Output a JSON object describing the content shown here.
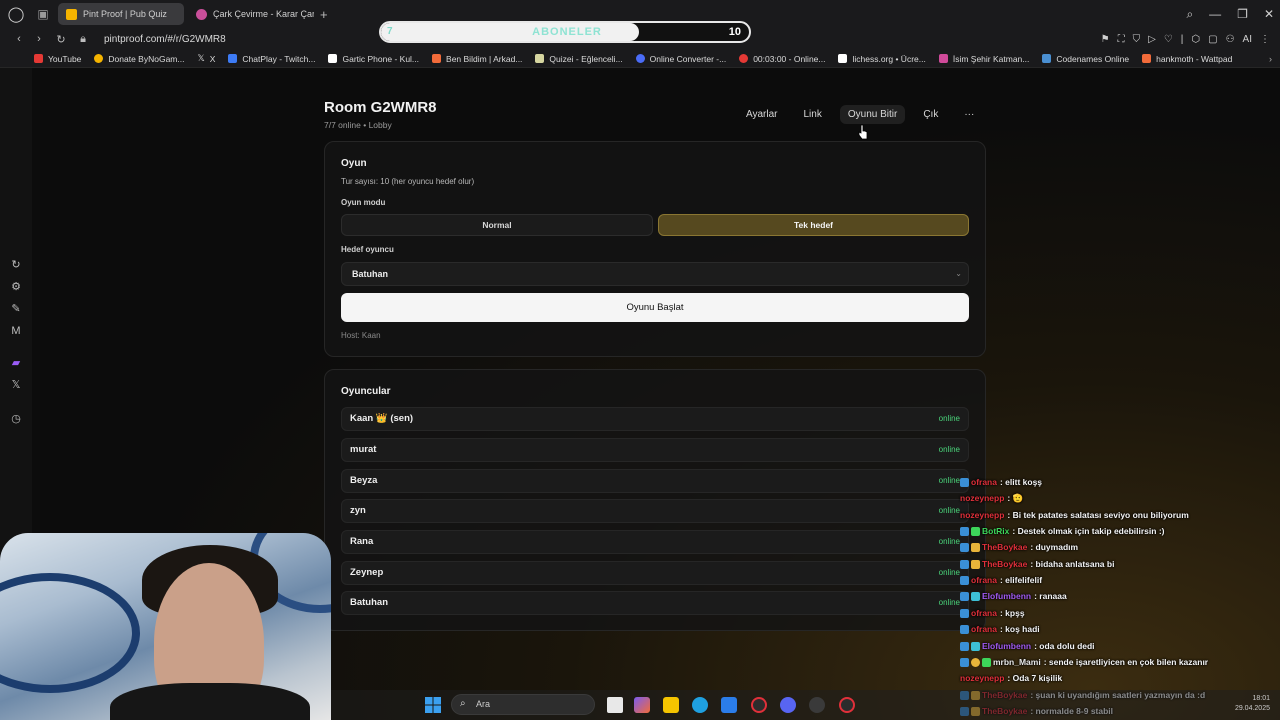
{
  "browser": {
    "tabs": [
      {
        "label": "Pint Proof | Pub Quiz",
        "active": true,
        "favicon_color": "#f5b400"
      },
      {
        "label": "Çark Çevirme - Karar Çark",
        "active": false,
        "favicon_color": "#c94f9a"
      }
    ],
    "url": "pintproof.com/#/r/G2WMR8",
    "bookmarks": [
      {
        "label": "YouTube",
        "color": "#e53935"
      },
      {
        "label": "Donate ByNoGam...",
        "color": "#f5b400"
      },
      {
        "label": "X",
        "color": "#ffffff"
      },
      {
        "label": "ChatPlay - Twitch...",
        "color": "#3d7bf5"
      },
      {
        "label": "Gartic Phone - Kul...",
        "color": "#ffffff"
      },
      {
        "label": "Ben Bildim | Arkad...",
        "color": "#f26b3a"
      },
      {
        "label": "Quizei - Eğlenceli...",
        "color": "#d6d6a0"
      },
      {
        "label": "Online Converter -...",
        "color": "#4a6cf7"
      },
      {
        "label": "00:03:00 - Online...",
        "color": "#e53935"
      },
      {
        "label": "lichess.org • Ücre...",
        "color": "#ffffff"
      },
      {
        "label": "İsim Şehir Katman...",
        "color": "#d04a9a"
      },
      {
        "label": "Codenames Online",
        "color": "#4a8fd1"
      },
      {
        "label": "hankmoth - Wattpad",
        "color": "#f26b3a"
      }
    ]
  },
  "subscriber_goal": {
    "start": "7",
    "label": "ABONELER",
    "goal": "10",
    "progress": 0.7
  },
  "room": {
    "title": "Room G2WMR8",
    "subtitle": "7/7 online • Lobby",
    "nav": [
      "Ayarlar",
      "Link",
      "Oyunu Bitir",
      "Çık",
      "···"
    ]
  },
  "game": {
    "title": "Oyun",
    "rounds_text": "Tur sayısı: 10 (her oyuncu hedef olur)",
    "mode_label": "Oyun modu",
    "modes": [
      {
        "label": "Normal",
        "selected": false
      },
      {
        "label": "Tek hedef",
        "selected": true
      }
    ],
    "target_label": "Hedef oyuncu",
    "target_value": "Batuhan",
    "start_button": "Oyunu Başlat",
    "host_text": "Host: Kaan"
  },
  "players": {
    "title": "Oyuncular",
    "list": [
      {
        "name": "Kaan 👑 (sen)",
        "status": "online"
      },
      {
        "name": "murat",
        "status": "online"
      },
      {
        "name": "Beyza",
        "status": "online"
      },
      {
        "name": "zyn",
        "status": "online"
      },
      {
        "name": "Rana",
        "status": "online"
      },
      {
        "name": "Zeynep",
        "status": "online"
      },
      {
        "name": "Batuhan",
        "status": "online"
      }
    ]
  },
  "chat": [
    {
      "user": "ofrana",
      "msg": ": elitt koşş",
      "color": "#e0303a"
    },
    {
      "user": "nozeynepp",
      "msg": ": 🫡",
      "color": "#e0303a"
    },
    {
      "user": "nozeynepp",
      "msg": ": Bi tek patates salatası seviyo onu biliyorum",
      "color": "#e0303a"
    },
    {
      "user": "BotRix",
      "msg": ": Destek olmak için takip edebilirsin :)",
      "color": "#3dd65a"
    },
    {
      "user": "TheBoykae",
      "msg": ": duymadım",
      "color": "#e0303a"
    },
    {
      "user": "TheBoykae",
      "msg": ": bidaha anlatsana bi",
      "color": "#e0303a"
    },
    {
      "user": "ofrana",
      "msg": ": elifelifelif",
      "color": "#e0303a"
    },
    {
      "user": "Elofumbenn",
      "msg": ": ranaaa",
      "color": "#a05af0"
    },
    {
      "user": "ofrana",
      "msg": ": kpşş",
      "color": "#e0303a"
    },
    {
      "user": "ofrana",
      "msg": ": koş hadi",
      "color": "#e0303a"
    },
    {
      "user": "Elofumbenn",
      "msg": ": oda dolu dedi",
      "color": "#a05af0"
    },
    {
      "user": "mrbn_Mami",
      "msg": ": sende işaretliyicen en çok bilen kazanır",
      "color": "#e8e8e8"
    },
    {
      "user": "nozeynepp",
      "msg": ": Oda 7 kişilik",
      "color": "#e0303a"
    },
    {
      "user": "TheBoykae",
      "msg": ": şuan ki uyandığım saatleri yazmayın da :d",
      "color": "#e0303a"
    },
    {
      "user": "TheBoykae",
      "msg": ": normalde 8-9 stabil",
      "color": "#e0303a"
    }
  ],
  "taskbar": {
    "search_placeholder": "Ara",
    "time": "18:01",
    "date": "29.04.2025"
  }
}
